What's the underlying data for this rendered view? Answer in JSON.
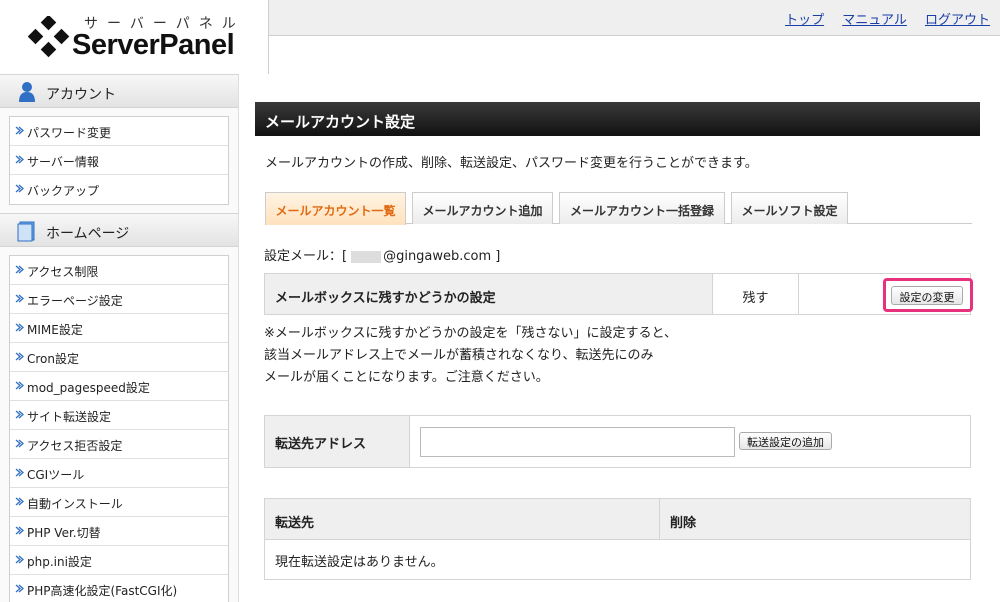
{
  "logo": {
    "kana": "サーバーパネル",
    "text": "ServerPanel"
  },
  "top_links": [
    "トップ",
    "マニュアル",
    "ログアウト"
  ],
  "sidebar": {
    "account": {
      "label": "アカウント",
      "items": [
        "パスワード変更",
        "サーバー情報",
        "バックアップ"
      ]
    },
    "homepage": {
      "label": "ホームページ",
      "items": [
        "アクセス制限",
        "エラーページ設定",
        "MIME設定",
        "Cron設定",
        "mod_pagespeed設定",
        "サイト転送設定",
        "アクセス拒否設定",
        "CGIツール",
        "自動インストール",
        "PHP Ver.切替",
        "php.ini設定",
        "PHP高速化設定(FastCGI化)"
      ]
    }
  },
  "main": {
    "title": "メールアカウント設定",
    "description": "メールアカウントの作成、削除、転送設定、パスワード変更を行うことができます。",
    "tabs": [
      "メールアカウント一覧",
      "メールアカウント追加",
      "メールアカウント一括登録",
      "メールソフト設定"
    ],
    "active_tab": 0,
    "mail_label": "設定メール：[",
    "mail_domain": "@gingaweb.com ]",
    "mailbox_setting": {
      "label": "メールボックスに残すかどうかの設定",
      "value": "残す",
      "button": "設定の変更"
    },
    "notice_lines": [
      "※メールボックスに残すかどうかの設定を「残さない」に設定すると、",
      "該当メールアドレス上でメールが蓄積されなくなり、転送先にのみ",
      "メールが届くことになります。ご注意ください。"
    ],
    "forward": {
      "label": "転送先アドレス",
      "input_value": "",
      "button": "転送設定の追加"
    },
    "forward_table": {
      "headers": [
        "転送先",
        "削除"
      ],
      "empty_message": "現在転送設定はありません。"
    }
  },
  "colors": {
    "highlight": "#e8317d",
    "active_tab_text": "#e06a12",
    "link": "#1a3ea8"
  }
}
